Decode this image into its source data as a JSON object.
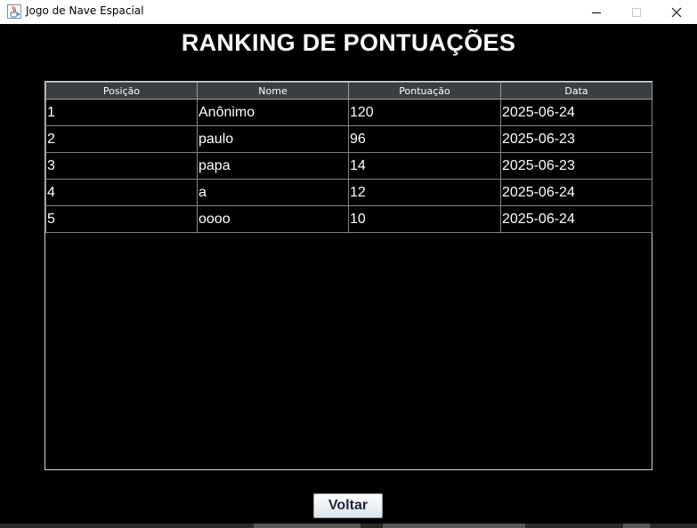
{
  "window": {
    "title": "Jogo de Nave Espacial",
    "icon": "java-cup-icon",
    "controls": [
      "minimize-icon",
      "maximize-icon",
      "close-icon"
    ]
  },
  "page": {
    "title": "RANKING DE PONTUAÇÕES"
  },
  "table": {
    "columns": [
      "Posição",
      "Nome",
      "Pontuação",
      "Data"
    ],
    "rows": [
      [
        "1",
        "Anônimo",
        "120",
        "2025-06-24"
      ],
      [
        "2",
        "paulo",
        "96",
        "2025-06-23"
      ],
      [
        "3",
        "papa",
        "14",
        "2025-06-23"
      ],
      [
        "4",
        "a",
        "12",
        "2025-06-24"
      ],
      [
        "5",
        "oooo",
        "10",
        "2025-06-24"
      ]
    ]
  },
  "actions": {
    "back_label": "Voltar"
  },
  "colors": {
    "background": "#000000",
    "header_bg": "#3a3d41",
    "text": "#ffffff",
    "grid": "#7f848a"
  }
}
